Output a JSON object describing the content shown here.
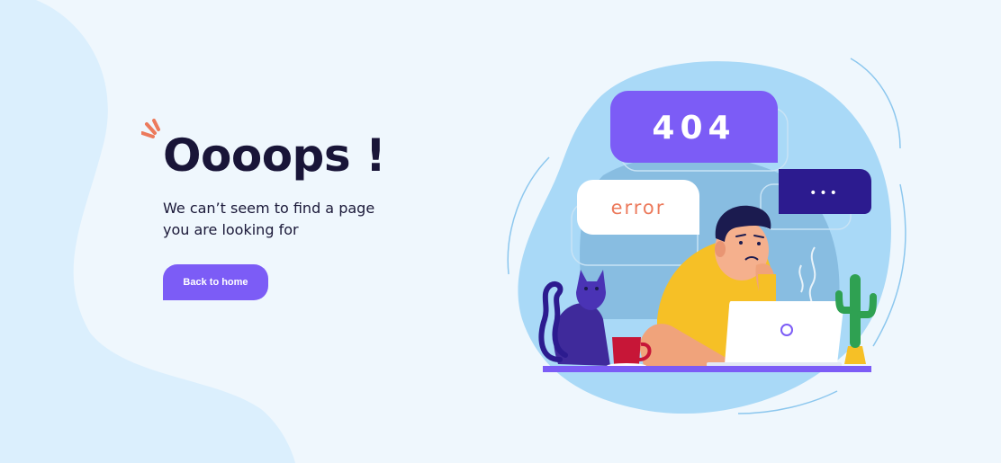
{
  "hero": {
    "title": "Oooops !",
    "message": "We can’t seem to find a page you are looking for",
    "button_label": "Back to home"
  },
  "illustration": {
    "code_bubble_text": "404",
    "error_bubble_text": "error",
    "typing_bubble_text": "•••"
  },
  "colors": {
    "background": "#eff7fd",
    "left_blob": "#dbeffd",
    "accent_purple": "#7c5cf6",
    "dark_navy": "#191538",
    "error_text": "#ec7a5c",
    "shirt_yellow": "#f6c026",
    "cat_purple": "#3f2a9b"
  },
  "icons": {
    "burst": "burst-icon",
    "laptop_logo": "ring-icon"
  }
}
